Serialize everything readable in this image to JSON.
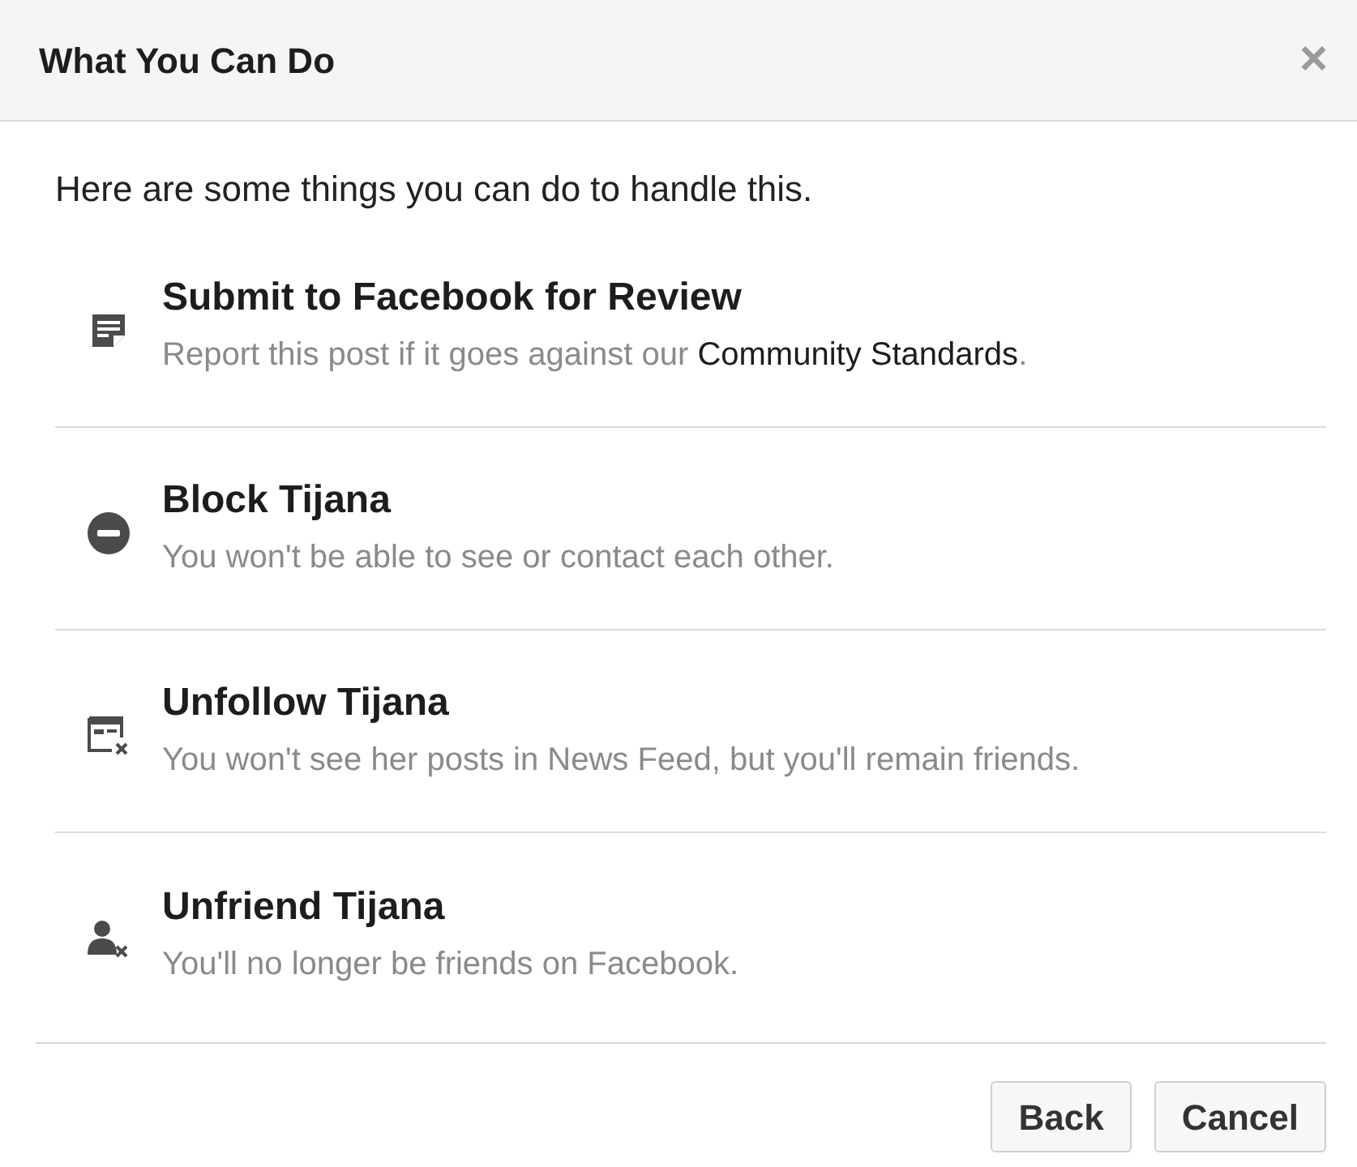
{
  "dialog": {
    "title": "What You Can Do",
    "close": "×"
  },
  "intro": "Here are some things you can do to handle this.",
  "options": [
    {
      "kind": "report",
      "title": "Submit to Facebook for Review",
      "description": "Report this post if it goes against our ",
      "link": "Community Standards",
      "description_end": "."
    },
    {
      "kind": "block",
      "title": "Block Tijana",
      "description": "You won't be able to see or contact each other."
    },
    {
      "kind": "unfollow",
      "title": "Unfollow Tijana",
      "description": "You won't see her posts in News Feed, but you'll remain friends."
    },
    {
      "kind": "unfriend",
      "title": "Unfriend Tijana",
      "description": "You'll no longer be friends on Facebook."
    }
  ],
  "buttons": [
    "Back",
    "Cancel"
  ]
}
